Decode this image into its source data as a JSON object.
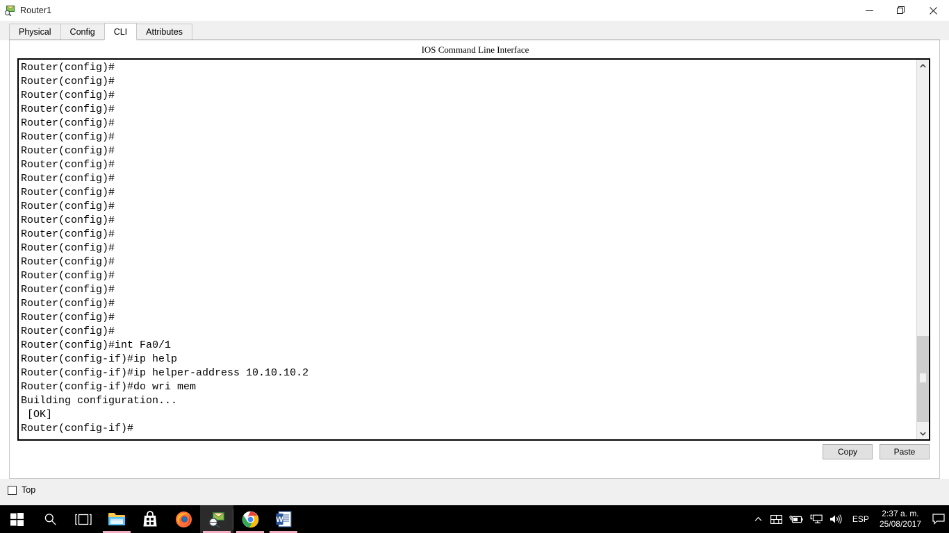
{
  "window": {
    "title": "Router1",
    "icon": "packet-tracer-icon",
    "controls": {
      "minimize": "Minimize",
      "restore": "Restore",
      "close": "Close"
    }
  },
  "tabs": [
    {
      "label": "Physical",
      "selected": false
    },
    {
      "label": "Config",
      "selected": false
    },
    {
      "label": "CLI",
      "selected": true
    },
    {
      "label": "Attributes",
      "selected": false
    }
  ],
  "cli": {
    "heading": "IOS Command Line Interface",
    "lines": [
      "Router(config)#",
      "Router(config)#",
      "Router(config)#",
      "Router(config)#",
      "Router(config)#",
      "Router(config)#",
      "Router(config)#",
      "Router(config)#",
      "Router(config)#",
      "Router(config)#",
      "Router(config)#",
      "Router(config)#",
      "Router(config)#",
      "Router(config)#",
      "Router(config)#",
      "Router(config)#",
      "Router(config)#",
      "Router(config)#",
      "Router(config)#",
      "Router(config)#",
      "Router(config)#int Fa0/1",
      "Router(config-if)#ip help",
      "Router(config-if)#ip helper-address 10.10.10.2",
      "Router(config-if)#do wri mem",
      "Building configuration...",
      " [OK]",
      "Router(config-if)#"
    ],
    "buttons": {
      "copy": "Copy",
      "paste": "Paste"
    },
    "scrollbar": {
      "up_arrow": "scroll-up-arrow-icon",
      "down_arrow": "scroll-down-arrow-icon"
    }
  },
  "bottom": {
    "top_checkbox_label": "Top",
    "top_checkbox_checked": false
  },
  "taskbar": {
    "items": [
      {
        "name": "start-button",
        "label": "Start",
        "open": false,
        "active": false
      },
      {
        "name": "search-button",
        "label": "Search",
        "open": false,
        "active": false
      },
      {
        "name": "task-view-button",
        "label": "Task View",
        "open": false,
        "active": false
      },
      {
        "name": "file-explorer",
        "label": "File Explorer",
        "open": true,
        "active": false
      },
      {
        "name": "microsoft-store",
        "label": "Microsoft Store",
        "open": false,
        "active": false
      },
      {
        "name": "firefox",
        "label": "Mozilla Firefox",
        "open": false,
        "active": false
      },
      {
        "name": "packet-tracer",
        "label": "Cisco Packet Tracer",
        "open": true,
        "active": true
      },
      {
        "name": "google-chrome",
        "label": "Google Chrome",
        "open": true,
        "active": false
      },
      {
        "name": "microsoft-word",
        "label": "Microsoft Word",
        "open": true,
        "active": false
      }
    ],
    "tray": {
      "show_hidden": "show-hidden-icons-chevron",
      "icons": [
        "touch-keyboard-icon",
        "battery-charging-icon",
        "network-icon",
        "volume-icon"
      ],
      "language": "ESP",
      "time": "2:37 a. m.",
      "date": "25/08/2017",
      "action_center": "action-center-icon"
    }
  },
  "colors": {
    "taskbar_bg": "#000000",
    "open_indicator": "#f4aec4",
    "tab_face": "#f0f0f0",
    "selected_tab": "#ffffff",
    "terminal_bg": "#ffffff",
    "terminal_fg": "#000000",
    "scrollbar_thumb": "#cdcdcd",
    "button_face": "#e1e1e1"
  }
}
